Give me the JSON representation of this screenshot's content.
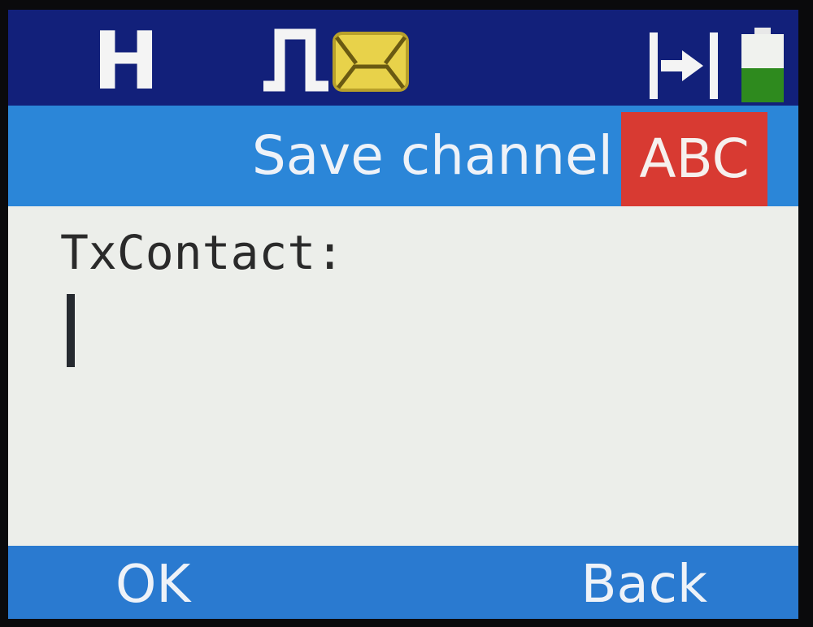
{
  "status_bar": {
    "mode_letter": "H",
    "icons": [
      "pulse-icon",
      "message-icon",
      "signal-icon",
      "battery-icon"
    ],
    "battery_level": 0.5,
    "colors": {
      "background": "#12207a",
      "message_icon": "#e8d24a",
      "battery_fill": "#2e8a1e"
    }
  },
  "title_bar": {
    "title": "Save channel",
    "input_mode": "ABC",
    "colors": {
      "background": "#2b86d8",
      "input_mode_badge": "#d83a32"
    }
  },
  "content": {
    "field_label": "TxContact:",
    "field_value": ""
  },
  "softkeys": {
    "left": "OK",
    "right": "Back",
    "colors": {
      "background": "#2a7ad0"
    }
  }
}
